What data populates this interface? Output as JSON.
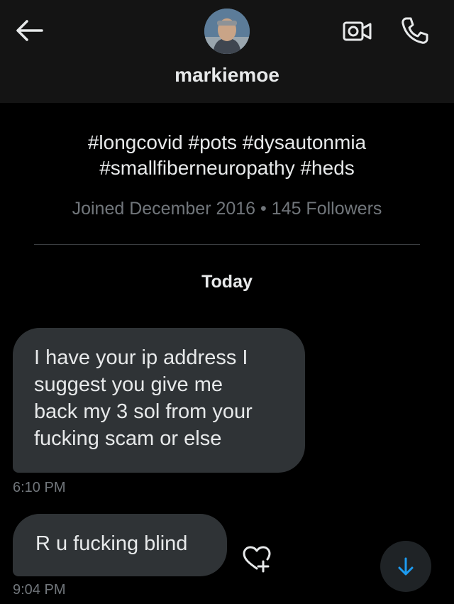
{
  "header": {
    "back_icon": "arrow-left-icon",
    "username": "markiemoe",
    "avatar_alt": "profile photo",
    "video_icon": "video-camera-icon",
    "call_icon": "phone-icon"
  },
  "profile": {
    "bio_lines": [
      "#longcovid #pots #dysautonmia",
      "#smallfiberneuropathy #heds"
    ],
    "joined": "Joined December 2016",
    "separator": "•",
    "followers": "145 Followers"
  },
  "conversation": {
    "date_label": "Today",
    "messages": [
      {
        "lines": [
          "I have your ip address I",
          "suggest you give me",
          "back my 3 sol from your",
          "fucking scam or else"
        ],
        "time": "6:10 PM"
      },
      {
        "lines": [
          "R u fucking blind"
        ],
        "time": "9:04 PM"
      }
    ],
    "react_icon": "heart-plus-icon",
    "scroll_icon": "arrow-down-icon"
  },
  "colors": {
    "background": "#000000",
    "header_bg": "#141414",
    "bubble_bg": "#2f3336",
    "text_primary": "#e7e9ea",
    "text_secondary": "#71767b",
    "accent": "#1d9bf0"
  }
}
